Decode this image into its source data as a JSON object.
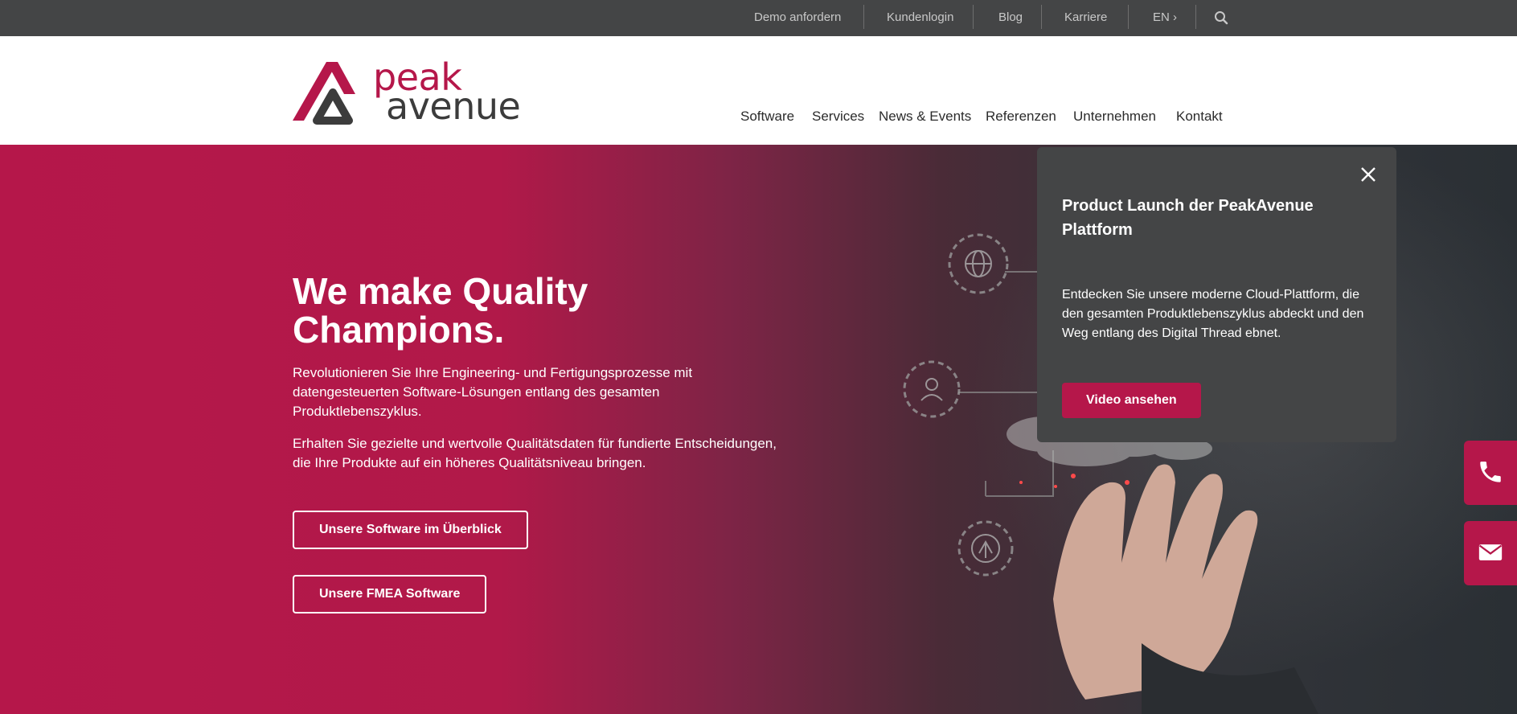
{
  "topbar": {
    "links": [
      "Demo anfordern",
      "Kundenlogin",
      "Blog",
      "Karriere",
      "EN ›"
    ],
    "search_icon": "search-icon"
  },
  "logo": {
    "line1": "peak",
    "line2": "avenue"
  },
  "nav": {
    "items": [
      "Software",
      "Services",
      "News & Events",
      "Referenzen",
      "Unternehmen",
      "Kontakt"
    ]
  },
  "hero": {
    "title": "We make Quality Champions.",
    "paragraph1": "Revolutionieren Sie Ihre Engineering- und Fertigungsprozesse mit datengesteuerten Software-Lösungen entlang des gesamten Produktlebenszyklus.",
    "paragraph2": "Erhalten Sie gezielte und wertvolle Qualitätsdaten für fundierte Entscheidungen, die Ihre Produkte auf ein höheres Qualitätsniveau bringen.",
    "button1": "Unsere Software im Überblick",
    "button2": "Unsere FMEA Software"
  },
  "popup": {
    "title": "Product Launch der PeakAvenue Plattform",
    "text": "Entdecken Sie unsere moderne Cloud-Plattform, die den gesamten Produktlebenszyklus abdeckt und den Weg entlang des Digital Thread ebnet.",
    "button": "Video ansehen",
    "close_icon": "close-icon"
  },
  "side": {
    "phone_icon": "phone-icon",
    "mail_icon": "mail-icon"
  },
  "colors": {
    "brand": "#b5174a",
    "dark": "#444546",
    "topbar": "#444546"
  }
}
